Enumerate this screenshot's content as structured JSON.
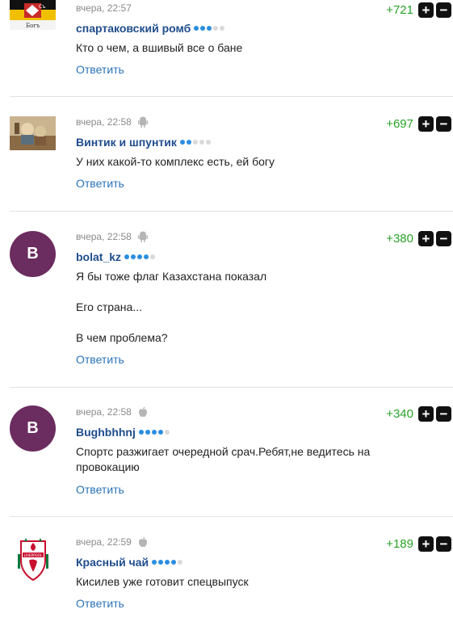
{
  "comments": [
    {
      "time": "вчера, 22:57",
      "author": "спартаковский ромб",
      "rating_level": 3,
      "score": "+721",
      "lines": [
        "Кто о чем, а вшивый все о бане"
      ],
      "reply": "Ответить",
      "avatar_kind": "flag",
      "avatar_text": "Богъ",
      "device": ""
    },
    {
      "time": "вчера, 22:58",
      "author": "Винтик и шпунтик",
      "rating_level": 2,
      "score": "+697",
      "lines": [
        "У них какой-то комплекс есть, ей богу"
      ],
      "reply": "Ответить",
      "avatar_kind": "photo",
      "device": "android"
    },
    {
      "time": "вчера, 22:58",
      "author": "bolat_kz",
      "rating_level": 4,
      "score": "+380",
      "lines": [
        "Я бы тоже флаг Казахстана показал",
        "Его страна...",
        "В чем проблема?"
      ],
      "reply": "Ответить",
      "avatar_kind": "letter",
      "avatar_text": "B",
      "device": "android"
    },
    {
      "time": "вчера, 22:58",
      "author": "Bughbhhnj",
      "rating_level": 4,
      "score": "+340",
      "lines": [
        "Спортс разжигает очередной срач.Ребят,не ведитесь на провокацию"
      ],
      "reply": "Ответить",
      "avatar_kind": "letter",
      "avatar_text": "B",
      "device": "apple"
    },
    {
      "time": "вчера, 22:59",
      "author": "Красный чай",
      "rating_level": 4,
      "score": "+189",
      "lines": [
        "Кисилев уже готовит спецвыпуск"
      ],
      "reply": "Ответить",
      "avatar_kind": "logo",
      "avatar_text": "LIVERPOOL",
      "device": "apple"
    }
  ],
  "colors": {
    "score": "#29a329",
    "author": "#1f4d8c",
    "reply": "#2a73b8",
    "dot_on": "#2a8ee0",
    "avatar_bg": "#6b2c5f"
  },
  "icons": {
    "upvote": "plus-icon",
    "downvote": "minus-icon",
    "android": "android-icon",
    "apple": "apple-icon"
  },
  "vote_symbols": {
    "up": "+",
    "down": "−"
  }
}
